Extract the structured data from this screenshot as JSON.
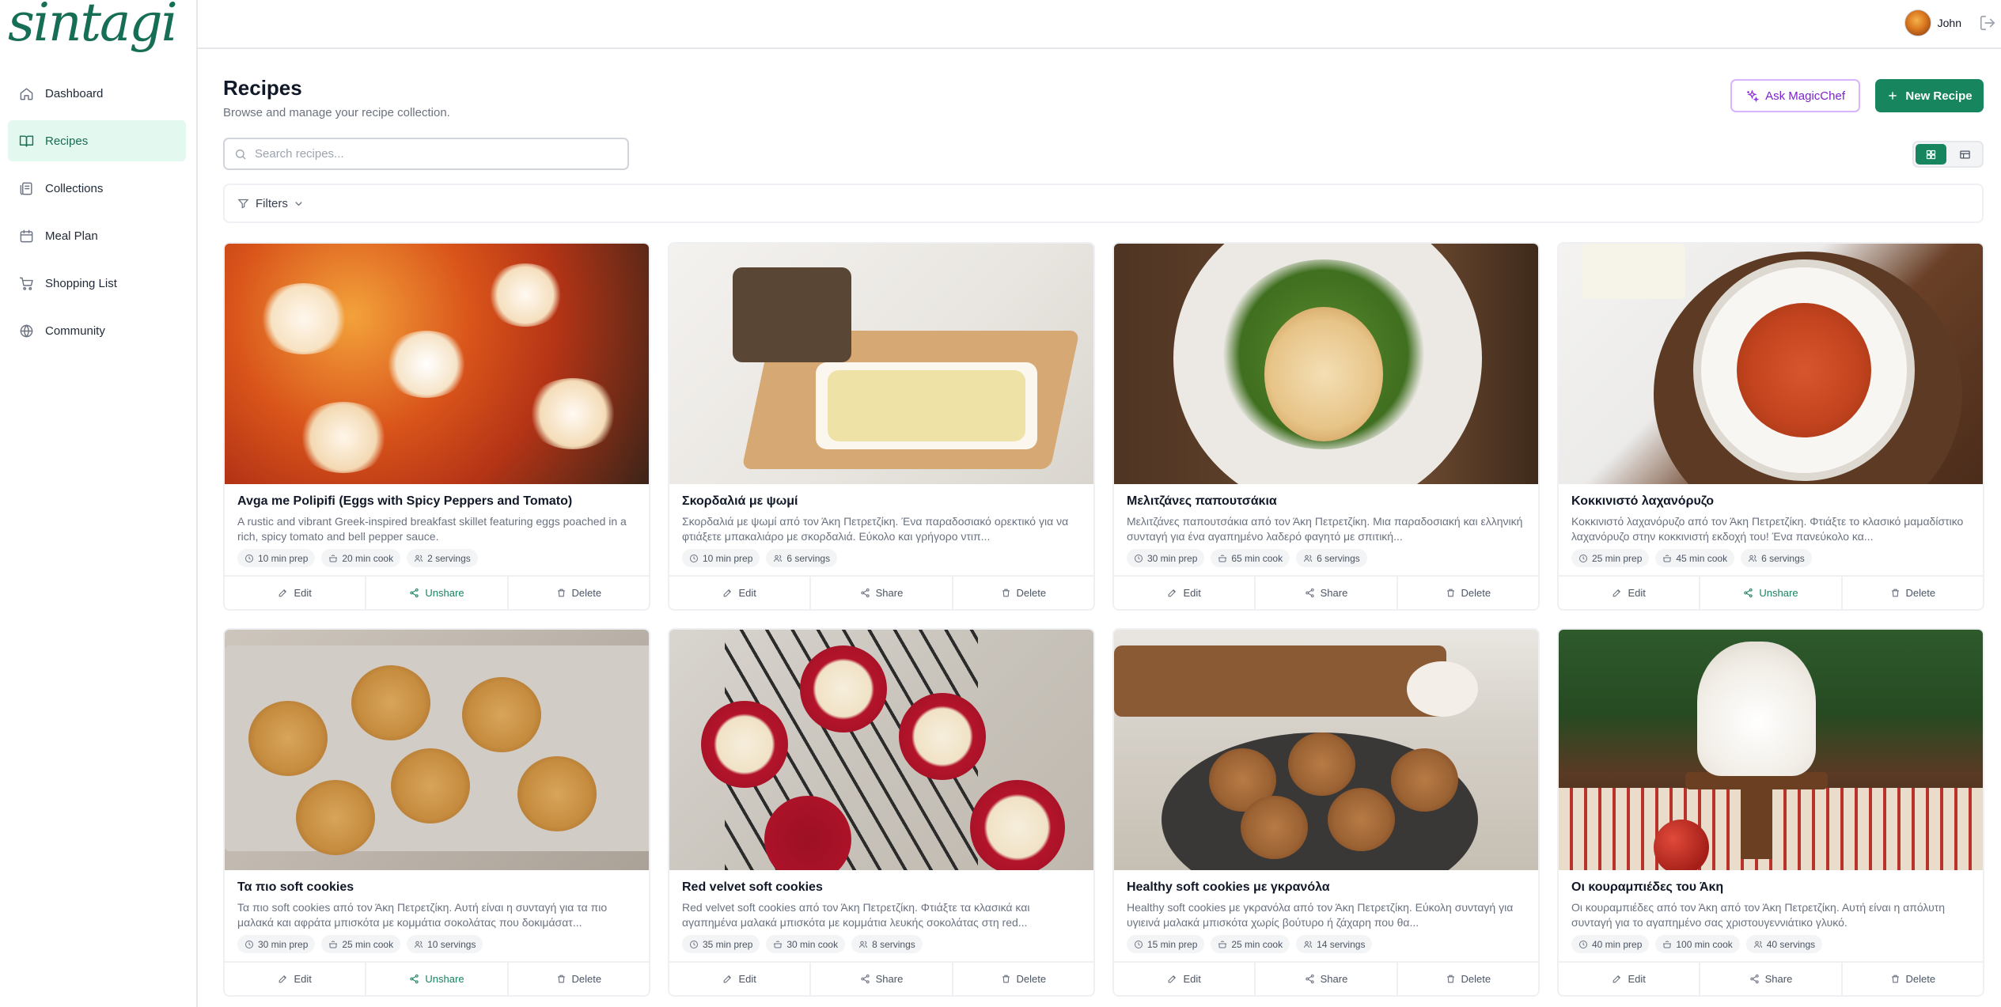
{
  "brand": {
    "logo_text": "sintagi",
    "accent": "#17855d"
  },
  "sidebar": {
    "items": [
      {
        "label": "Dashboard",
        "icon": "home-icon",
        "active": false
      },
      {
        "label": "Recipes",
        "icon": "book-icon",
        "active": true
      },
      {
        "label": "Collections",
        "icon": "collection-icon",
        "active": false
      },
      {
        "label": "Meal Plan",
        "icon": "calendar-icon",
        "active": false
      },
      {
        "label": "Shopping List",
        "icon": "cart-icon",
        "active": false
      },
      {
        "label": "Community",
        "icon": "globe-icon",
        "active": false
      }
    ]
  },
  "topbar": {
    "user_name": "John",
    "logout_icon": "logout-icon"
  },
  "header": {
    "title": "Recipes",
    "subtitle": "Browse and manage your recipe collection.",
    "magic_label": "Ask MagicChef",
    "new_label": "New Recipe"
  },
  "search": {
    "placeholder": "Search recipes...",
    "value": ""
  },
  "filters": {
    "label": "Filters"
  },
  "view": {
    "active": "grid"
  },
  "recipes": [
    {
      "title": "Avga me Polipifi (Eggs with Spicy Peppers and Tomato)",
      "desc": "A rustic and vibrant Greek-inspired breakfast skillet featuring eggs poached in a rich, spicy tomato and bell pepper sauce.",
      "meta": [
        "10 min prep",
        "20 min cook",
        "2 servings"
      ],
      "actions": [
        "Edit",
        "Unshare",
        "Delete"
      ],
      "shared": true
    },
    {
      "title": "Σκορδαλιά με ψωμί",
      "desc": "Σκορδαλιά με ψωμί από τον Άκη Πετρετζίκη. Ένα παραδοσιακό ορεκτικό για να φτιάξετε μπακαλιάρο με σκορδαλιά. Εύκολο και γρήγορο ντιπ...",
      "meta": [
        "10 min prep",
        "6 servings"
      ],
      "actions": [
        "Edit",
        "Share",
        "Delete"
      ],
      "shared": false
    },
    {
      "title": "Μελιτζάνες παπουτσάκια",
      "desc": "Μελιτζάνες παπουτσάκια από τον Άκη Πετρετζίκη. Μια παραδοσιακή και ελληνική συνταγή για ένα αγαπημένο λαδερό φαγητό με σπιτική...",
      "meta": [
        "30 min prep",
        "65 min cook",
        "6 servings"
      ],
      "actions": [
        "Edit",
        "Share",
        "Delete"
      ],
      "shared": false
    },
    {
      "title": "Κοκκινιστό λαχανόρυζο",
      "desc": "Κοκκινιστό λαχανόρυζο από τον Άκη Πετρετζίκη. Φτιάξτε το κλασικό μαμαδίστικο λαχανόρυζο στην κοκκινιστή εκδοχή του! Ένα πανεύκολο κα...",
      "meta": [
        "25 min prep",
        "45 min cook",
        "6 servings"
      ],
      "actions": [
        "Edit",
        "Unshare",
        "Delete"
      ],
      "shared": true
    },
    {
      "title": "Τα πιο soft cookies",
      "desc": "Τα πιο soft cookies από τον Άκη Πετρετζίκη. Αυτή είναι η συνταγή για τα πιο μαλακά και αφράτα μπισκότα με κομμάτια σοκολάτας που δοκιμάσατ...",
      "meta": [
        "30 min prep",
        "25 min cook",
        "10 servings"
      ],
      "actions": [
        "Edit",
        "Unshare",
        "Delete"
      ],
      "shared": true
    },
    {
      "title": "Red velvet soft cookies",
      "desc": "Red velvet soft cookies από τον Άκη Πετρετζίκη. Φτιάξτε τα κλασικά και αγαπημένα μαλακά μπισκότα με κομμάτια λευκής σοκολάτας στη red...",
      "meta": [
        "35 min prep",
        "30 min cook",
        "8 servings"
      ],
      "actions": [
        "Edit",
        "Share",
        "Delete"
      ],
      "shared": false
    },
    {
      "title": "Healthy soft cookies με γκρανόλα",
      "desc": "Healthy soft cookies με γκρανόλα από τον Άκη Πετρετζίκη. Εύκολη συνταγή για υγιεινά μαλακά μπισκότα χωρίς βούτυρο ή ζάχαρη που θα...",
      "meta": [
        "15 min prep",
        "25 min cook",
        "14 servings"
      ],
      "actions": [
        "Edit",
        "Share",
        "Delete"
      ],
      "shared": false
    },
    {
      "title": "Οι κουραμπιέδες του Άκη",
      "desc": "Οι κουραμπιέδες από τον Άκη από τον Άκη Πετρετζίκη. Αυτή είναι η απόλυτη συνταγή για το αγαπημένο σας χριστουγεννιάτικο γλυκό.",
      "meta": [
        "40 min prep",
        "100 min cook",
        "40 servings"
      ],
      "actions": [
        "Edit",
        "Share",
        "Delete"
      ],
      "shared": false
    }
  ]
}
